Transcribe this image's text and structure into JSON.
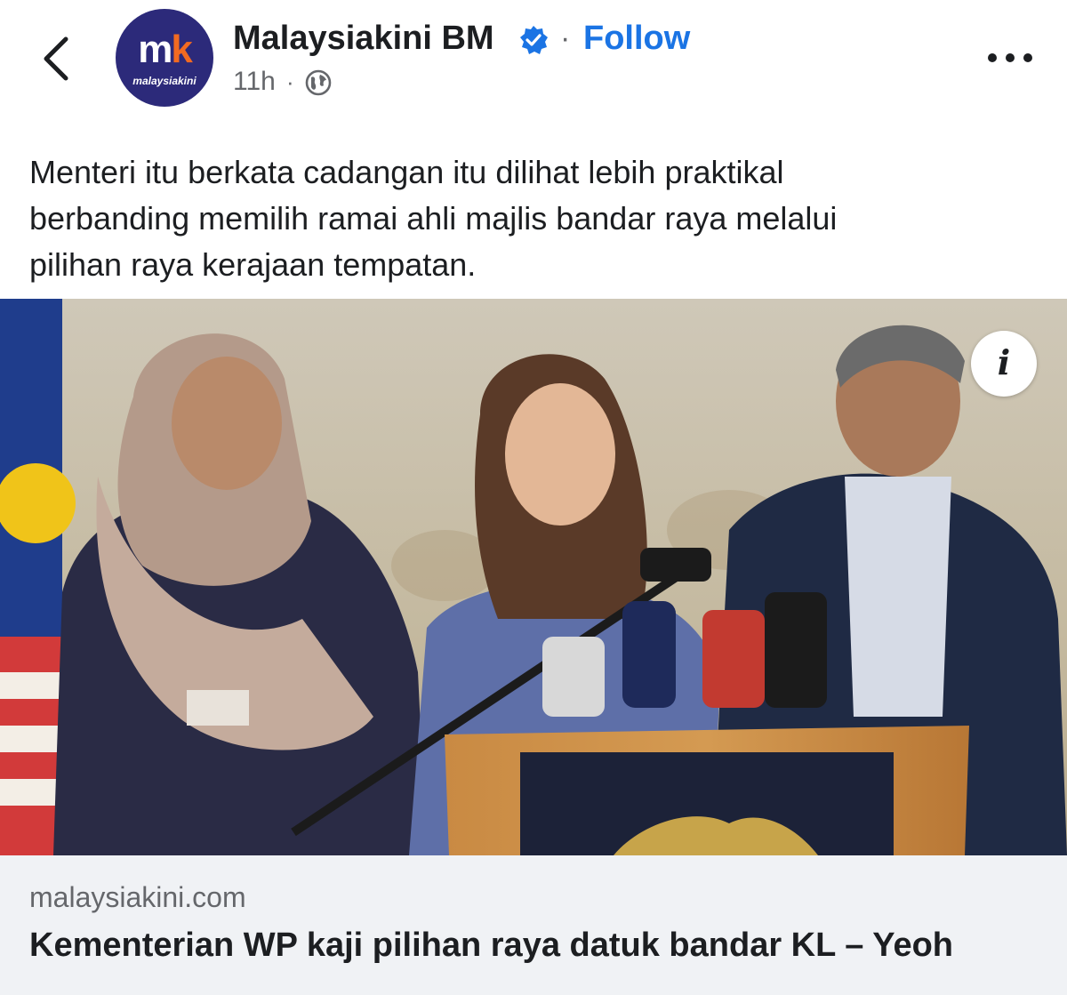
{
  "post": {
    "page_name": "Malaysiakini BM",
    "follow_label": "Follow",
    "separator": "·",
    "time": "11h",
    "meta_separator": "·",
    "caption": "Menteri itu berkata cadangan itu dilihat lebih praktikal\nberbanding memilih ramai ahli majlis bandar raya melalui\npilihan raya kerajaan tempatan.",
    "avatar": {
      "logo_m": "m",
      "logo_k": "k",
      "brand_text": "malaysiakini",
      "background_color": "#2c2a7a",
      "accent_color": "#f26a21"
    }
  },
  "link_card": {
    "domain": "malaysiakini.com",
    "headline": "Kementerian WP kaji pilihan raya datuk bandar KL – Yeoh",
    "info_label": "i"
  },
  "icons": {
    "back": "chevron-left-icon",
    "verified": "verified-badge-icon",
    "globe": "globe-icon",
    "more": "more-horizontal-icon",
    "info": "info-icon"
  },
  "colors": {
    "link_blue": "#1b74e4",
    "verified_blue": "#1b74e4",
    "secondary_text": "#65676b",
    "card_footer_bg": "#f0f2f5"
  }
}
